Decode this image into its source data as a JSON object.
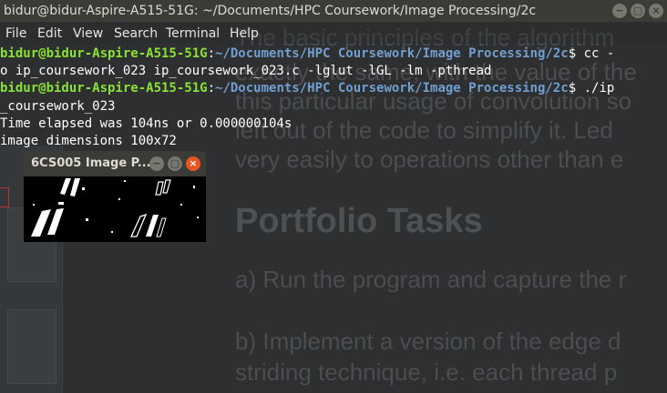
{
  "window": {
    "title": "bidur@bidur-Aspire-A515-51G: ~/Documents/HPC Coursework/Image Processing/2c",
    "min_glyph": "−",
    "max_glyph": "▢",
    "close_glyph": "×"
  },
  "menu": [
    "File",
    "Edit",
    "View",
    "Search",
    "Terminal",
    "Help"
  ],
  "terminal": {
    "user_host": "bidur@bidur-Aspire-A515-51G",
    "colon": ":",
    "path": "~/Documents/HPC Coursework/Image Processing/2c",
    "cmd1": "$ cc -",
    "line2": "o ip_coursework_023 ip_coursework_023.c -lglut -lGL -lm -pthread",
    "cmd2": "$ ./ip",
    "line4": "_coursework_023",
    "line5": "Time elapsed was 104ns or 0.000000104s",
    "line6": "image dimensions 100x72"
  },
  "image_window": {
    "title": "6CS005 Image P...",
    "min_glyph": "−",
    "max_glyph": "▢",
    "close_glyph": "×"
  },
  "background_document": {
    "line1": "The basic principles of the algorithm",
    "line2": "exactly the same, with the value of the",
    "line3": "this particular usage of convolution so",
    "line4": "left out of the code to simplify it. Led",
    "line5": "very easily to operations other than e",
    "heading": "Portfolio Tasks",
    "task_a": "a) Run the program and capture the r",
    "task_b1": "b) Implement a version of the edge d",
    "task_b2": "striding technique, i.e. each thread p"
  },
  "colors": {
    "prompt_user": "#8ae234",
    "prompt_path": "#729fcf",
    "close_button": "#e95420"
  }
}
